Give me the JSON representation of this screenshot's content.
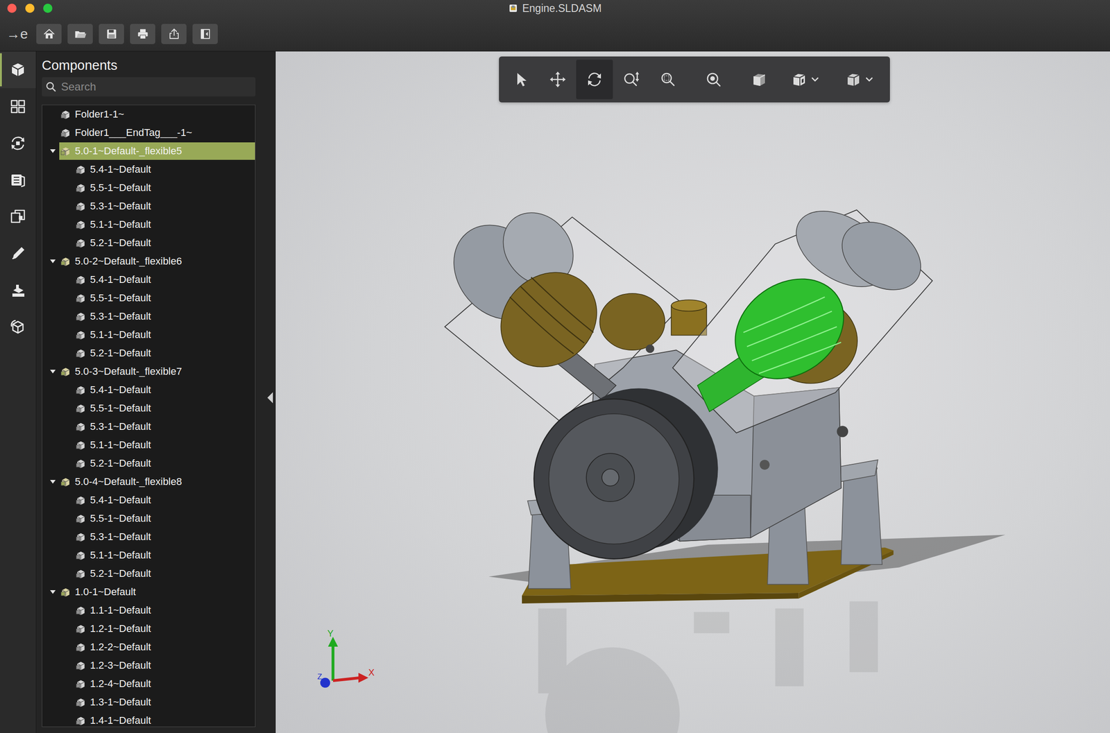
{
  "window": {
    "title": "Engine.SLDASM"
  },
  "logo": "→e",
  "title_toolbar": [
    {
      "kind": "home"
    },
    {
      "kind": "open"
    },
    {
      "kind": "save"
    },
    {
      "kind": "print"
    },
    {
      "kind": "share"
    },
    {
      "kind": "sidebar"
    }
  ],
  "rail": [
    {
      "kind": "components",
      "selected": true
    },
    {
      "kind": "views",
      "selected": false
    },
    {
      "kind": "animations",
      "selected": false
    },
    {
      "kind": "library",
      "selected": false
    },
    {
      "kind": "measure",
      "selected": false
    },
    {
      "kind": "markup",
      "selected": false
    },
    {
      "kind": "section",
      "selected": false
    },
    {
      "kind": "explode",
      "selected": false
    }
  ],
  "panel": {
    "title": "Components",
    "search": {
      "placeholder": "Search"
    }
  },
  "tree": [
    {
      "label": "Folder1-1~",
      "depth": 0,
      "kind": "item",
      "selected": false
    },
    {
      "label": "Folder1___EndTag___-1~",
      "depth": 0,
      "kind": "item",
      "selected": false
    },
    {
      "label": "5.0-1~Default-_flexible5",
      "depth": 0,
      "kind": "group",
      "expanded": true,
      "selected": true
    },
    {
      "label": "5.4-1~Default",
      "depth": 1,
      "kind": "part",
      "selected": false
    },
    {
      "label": "5.5-1~Default",
      "depth": 1,
      "kind": "part",
      "selected": false
    },
    {
      "label": "5.3-1~Default",
      "depth": 1,
      "kind": "part",
      "selected": false
    },
    {
      "label": "5.1-1~Default",
      "depth": 1,
      "kind": "part",
      "selected": false
    },
    {
      "label": "5.2-1~Default",
      "depth": 1,
      "kind": "part",
      "selected": false
    },
    {
      "label": "5.0-2~Default-_flexible6",
      "depth": 0,
      "kind": "group",
      "expanded": true,
      "selected": false
    },
    {
      "label": "5.4-1~Default",
      "depth": 1,
      "kind": "part",
      "selected": false
    },
    {
      "label": "5.5-1~Default",
      "depth": 1,
      "kind": "part",
      "selected": false
    },
    {
      "label": "5.3-1~Default",
      "depth": 1,
      "kind": "part",
      "selected": false
    },
    {
      "label": "5.1-1~Default",
      "depth": 1,
      "kind": "part",
      "selected": false
    },
    {
      "label": "5.2-1~Default",
      "depth": 1,
      "kind": "part",
      "selected": false
    },
    {
      "label": "5.0-3~Default-_flexible7",
      "depth": 0,
      "kind": "group",
      "expanded": true,
      "selected": false
    },
    {
      "label": "5.4-1~Default",
      "depth": 1,
      "kind": "part",
      "selected": false
    },
    {
      "label": "5.5-1~Default",
      "depth": 1,
      "kind": "part",
      "selected": false
    },
    {
      "label": "5.3-1~Default",
      "depth": 1,
      "kind": "part",
      "selected": false
    },
    {
      "label": "5.1-1~Default",
      "depth": 1,
      "kind": "part",
      "selected": false
    },
    {
      "label": "5.2-1~Default",
      "depth": 1,
      "kind": "part",
      "selected": false
    },
    {
      "label": "5.0-4~Default-_flexible8",
      "depth": 0,
      "kind": "group",
      "expanded": true,
      "selected": false
    },
    {
      "label": "5.4-1~Default",
      "depth": 1,
      "kind": "part",
      "selected": false
    },
    {
      "label": "5.5-1~Default",
      "depth": 1,
      "kind": "part",
      "selected": false
    },
    {
      "label": "5.3-1~Default",
      "depth": 1,
      "kind": "part",
      "selected": false
    },
    {
      "label": "5.1-1~Default",
      "depth": 1,
      "kind": "part",
      "selected": false
    },
    {
      "label": "5.2-1~Default",
      "depth": 1,
      "kind": "part",
      "selected": false
    },
    {
      "label": "1.0-1~Default",
      "depth": 0,
      "kind": "group",
      "expanded": true,
      "selected": false
    },
    {
      "label": "1.1-1~Default",
      "depth": 1,
      "kind": "part",
      "selected": false
    },
    {
      "label": "1.2-1~Default",
      "depth": 1,
      "kind": "part",
      "selected": false
    },
    {
      "label": "1.2-2~Default",
      "depth": 1,
      "kind": "part",
      "selected": false
    },
    {
      "label": "1.2-3~Default",
      "depth": 1,
      "kind": "part",
      "selected": false
    },
    {
      "label": "1.2-4~Default",
      "depth": 1,
      "kind": "part",
      "selected": false
    },
    {
      "label": "1.3-1~Default",
      "depth": 1,
      "kind": "part",
      "selected": false
    },
    {
      "label": "1.4-1~Default",
      "depth": 1,
      "kind": "part",
      "selected": false
    }
  ],
  "view_toolbar": [
    {
      "kind": "select",
      "selected": false,
      "dropdown": false
    },
    {
      "kind": "pan",
      "selected": false,
      "dropdown": false
    },
    {
      "kind": "rotate",
      "selected": true,
      "dropdown": false
    },
    {
      "kind": "zoom",
      "selected": false,
      "dropdown": false
    },
    {
      "kind": "zoom-area",
      "selected": false,
      "dropdown": false
    },
    {
      "kind": "zoom-fit",
      "selected": false,
      "dropdown": false
    },
    {
      "kind": "standard-views",
      "selected": false,
      "dropdown": false
    },
    {
      "kind": "display-style",
      "selected": false,
      "dropdown": true
    },
    {
      "kind": "hide-show",
      "selected": false,
      "dropdown": true
    }
  ],
  "axes": {
    "y": "Y",
    "x": "X",
    "z": "Z"
  }
}
